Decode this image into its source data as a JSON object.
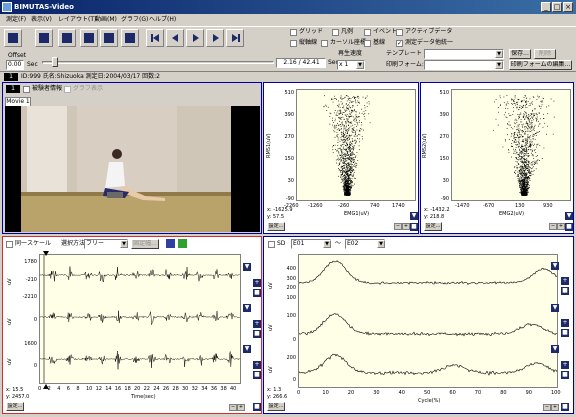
{
  "window": {
    "title": "BIMUTAS-Video"
  },
  "menu": {
    "items": [
      "測定(F)",
      "表示(V)",
      "レイアウト(T)",
      "動画(M)",
      "グラフ(G)",
      "ヘルプ(H)"
    ]
  },
  "toolbar": {
    "checks": {
      "grid": "グリッド",
      "legend": "凡例",
      "event": "イベント",
      "active_data": "アクティブデータ",
      "vertical": "縦軸線",
      "cursor_coord": "カーソル座標",
      "baseline": "基線",
      "measure_unify": "測定データ他統一"
    },
    "offset_label": "Offset",
    "offset_value": "0.00",
    "sec_label": "Sec",
    "time_display": "2.16 / 42.41",
    "sec_label2": "Sec",
    "speed_label": "再生速度",
    "speed_value": "x 1",
    "template_label": "テンプレート",
    "print_form_label": "印刷フォーム:",
    "save_button": "保存...",
    "delete_button": "削除",
    "edit_print_button": "印刷フォームの編集..."
  },
  "info_bar": {
    "num": "1",
    "text": "ID:999 氏名:Shizuoka 測定日:2004/03/17 回数:2"
  },
  "video_panel": {
    "num": "1",
    "subject_info": "被験者情報",
    "graph_display": "グラフ表示",
    "tab": "Movie 1"
  },
  "scatter1": {
    "y_ticks": [
      "510",
      "390",
      "270",
      "150",
      "30",
      "-90"
    ],
    "x_ticks": [
      "-2260",
      "-1260",
      "-260",
      "740",
      "1740"
    ],
    "ylabel": "RMS1(uV)",
    "xlabel": "EMG1(uV)",
    "x_readout": "x: -1625.9",
    "y_readout": "y: 57.5",
    "settings_button": "設定..."
  },
  "scatter2": {
    "y_ticks": [
      "510",
      "390",
      "270",
      "150",
      "30",
      "-90"
    ],
    "x_ticks": [
      "-1470",
      "-670",
      "130",
      "930"
    ],
    "ylabel": "RMS2(uV)",
    "xlabel": "EMG2(uV)",
    "x_readout": "x: -1432.2",
    "y_readout": "y: 218.8",
    "settings_button": "設定..."
  },
  "emg_panel": {
    "same_scale": "同一スケール",
    "select_method_label": "選択方法",
    "select_method_value": "フリー",
    "fixed_label": "固定幅...",
    "ch1_ticks": [
      "1780",
      "-210",
      "-2210"
    ],
    "ch2_ticks": [
      "0"
    ],
    "ch3_ticks": [
      "1600",
      "0"
    ],
    "ylabel": "uV",
    "x_ticks": [
      "0",
      "2",
      "4",
      "6",
      "8",
      "10",
      "12",
      "14",
      "16",
      "18",
      "20",
      "22",
      "24",
      "26",
      "28",
      "30",
      "32",
      "34",
      "36",
      "38",
      "40"
    ],
    "xlabel": "Time(sec)",
    "x_readout": "x: 15.5",
    "y_readout": "y: 2457.0",
    "settings_button": "設定..."
  },
  "cycle_panel": {
    "sd_label": "SD",
    "from_value": "E01",
    "tilde": "〜",
    "to_value": "E02",
    "ch1_ticks": [
      "400",
      "300",
      "200",
      "100"
    ],
    "ch2_ticks": [
      "100",
      "0"
    ],
    "ch3_ticks": [
      "200",
      "0"
    ],
    "ylabel": "uV",
    "x_ticks": [
      "0",
      "10",
      "20",
      "30",
      "40",
      "50",
      "60",
      "70",
      "80",
      "90",
      "100"
    ],
    "xlabel": "Cycle(%)",
    "x_readout": "x: 1.3",
    "y_readout": "y: 266.6",
    "settings_button": "設定..."
  },
  "colors": {
    "panel_border": "#0000aa",
    "emg_panel_border": "#cc3030",
    "plot_bg": "#ffffe8",
    "title_bar": "#0a246a"
  }
}
